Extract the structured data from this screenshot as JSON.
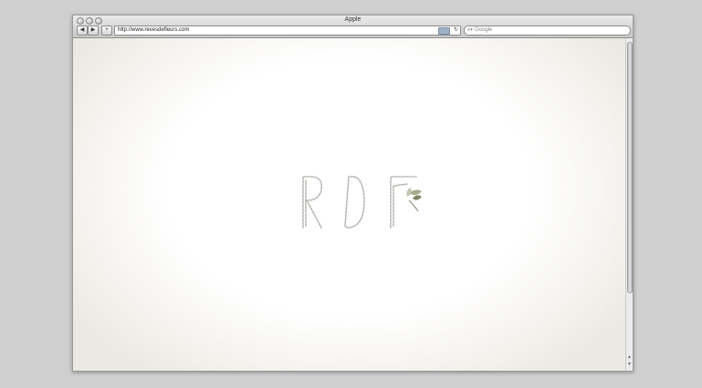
{
  "window": {
    "title": "Apple"
  },
  "toolbar": {
    "back_icon": "◀",
    "forward_icon": "▶",
    "add_icon": "+",
    "url": "http://www.revesdefleurs.com",
    "reload_icon": "↻",
    "search_placeholder": "Google",
    "search_icon": "⌕▾"
  },
  "scrollbar": {
    "up_icon": "▲",
    "down_icon": "▼"
  },
  "logo": {
    "letters": [
      "R",
      "D",
      "F"
    ]
  }
}
